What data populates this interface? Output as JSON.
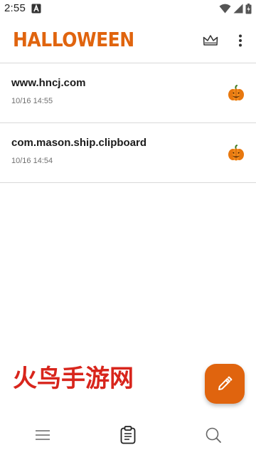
{
  "status_bar": {
    "time": "2:55",
    "icons": [
      "notification-a-icon",
      "wifi-icon",
      "signal-icon",
      "battery-charging-icon"
    ]
  },
  "app_bar": {
    "title": "HALLOWEEN",
    "actions": [
      "crown-icon",
      "more-vert-icon"
    ],
    "accent_color": "#e0640e"
  },
  "clipboard_items": [
    {
      "text": "www.hncj.com",
      "time": "10/16 14:55",
      "icon": "pumpkin-icon"
    },
    {
      "text": "com.mason.ship.clipboard",
      "time": "10/16 14:54",
      "icon": "pumpkin-icon"
    }
  ],
  "watermark": {
    "text": "火鸟手游网",
    "color": "#d8251c"
  },
  "fab": {
    "icon": "pencil-icon",
    "color": "#e0640e"
  },
  "bottom_nav": {
    "items": [
      {
        "icon": "menu-icon"
      },
      {
        "icon": "clipboard-icon",
        "selected": true
      },
      {
        "icon": "search-icon"
      }
    ]
  }
}
